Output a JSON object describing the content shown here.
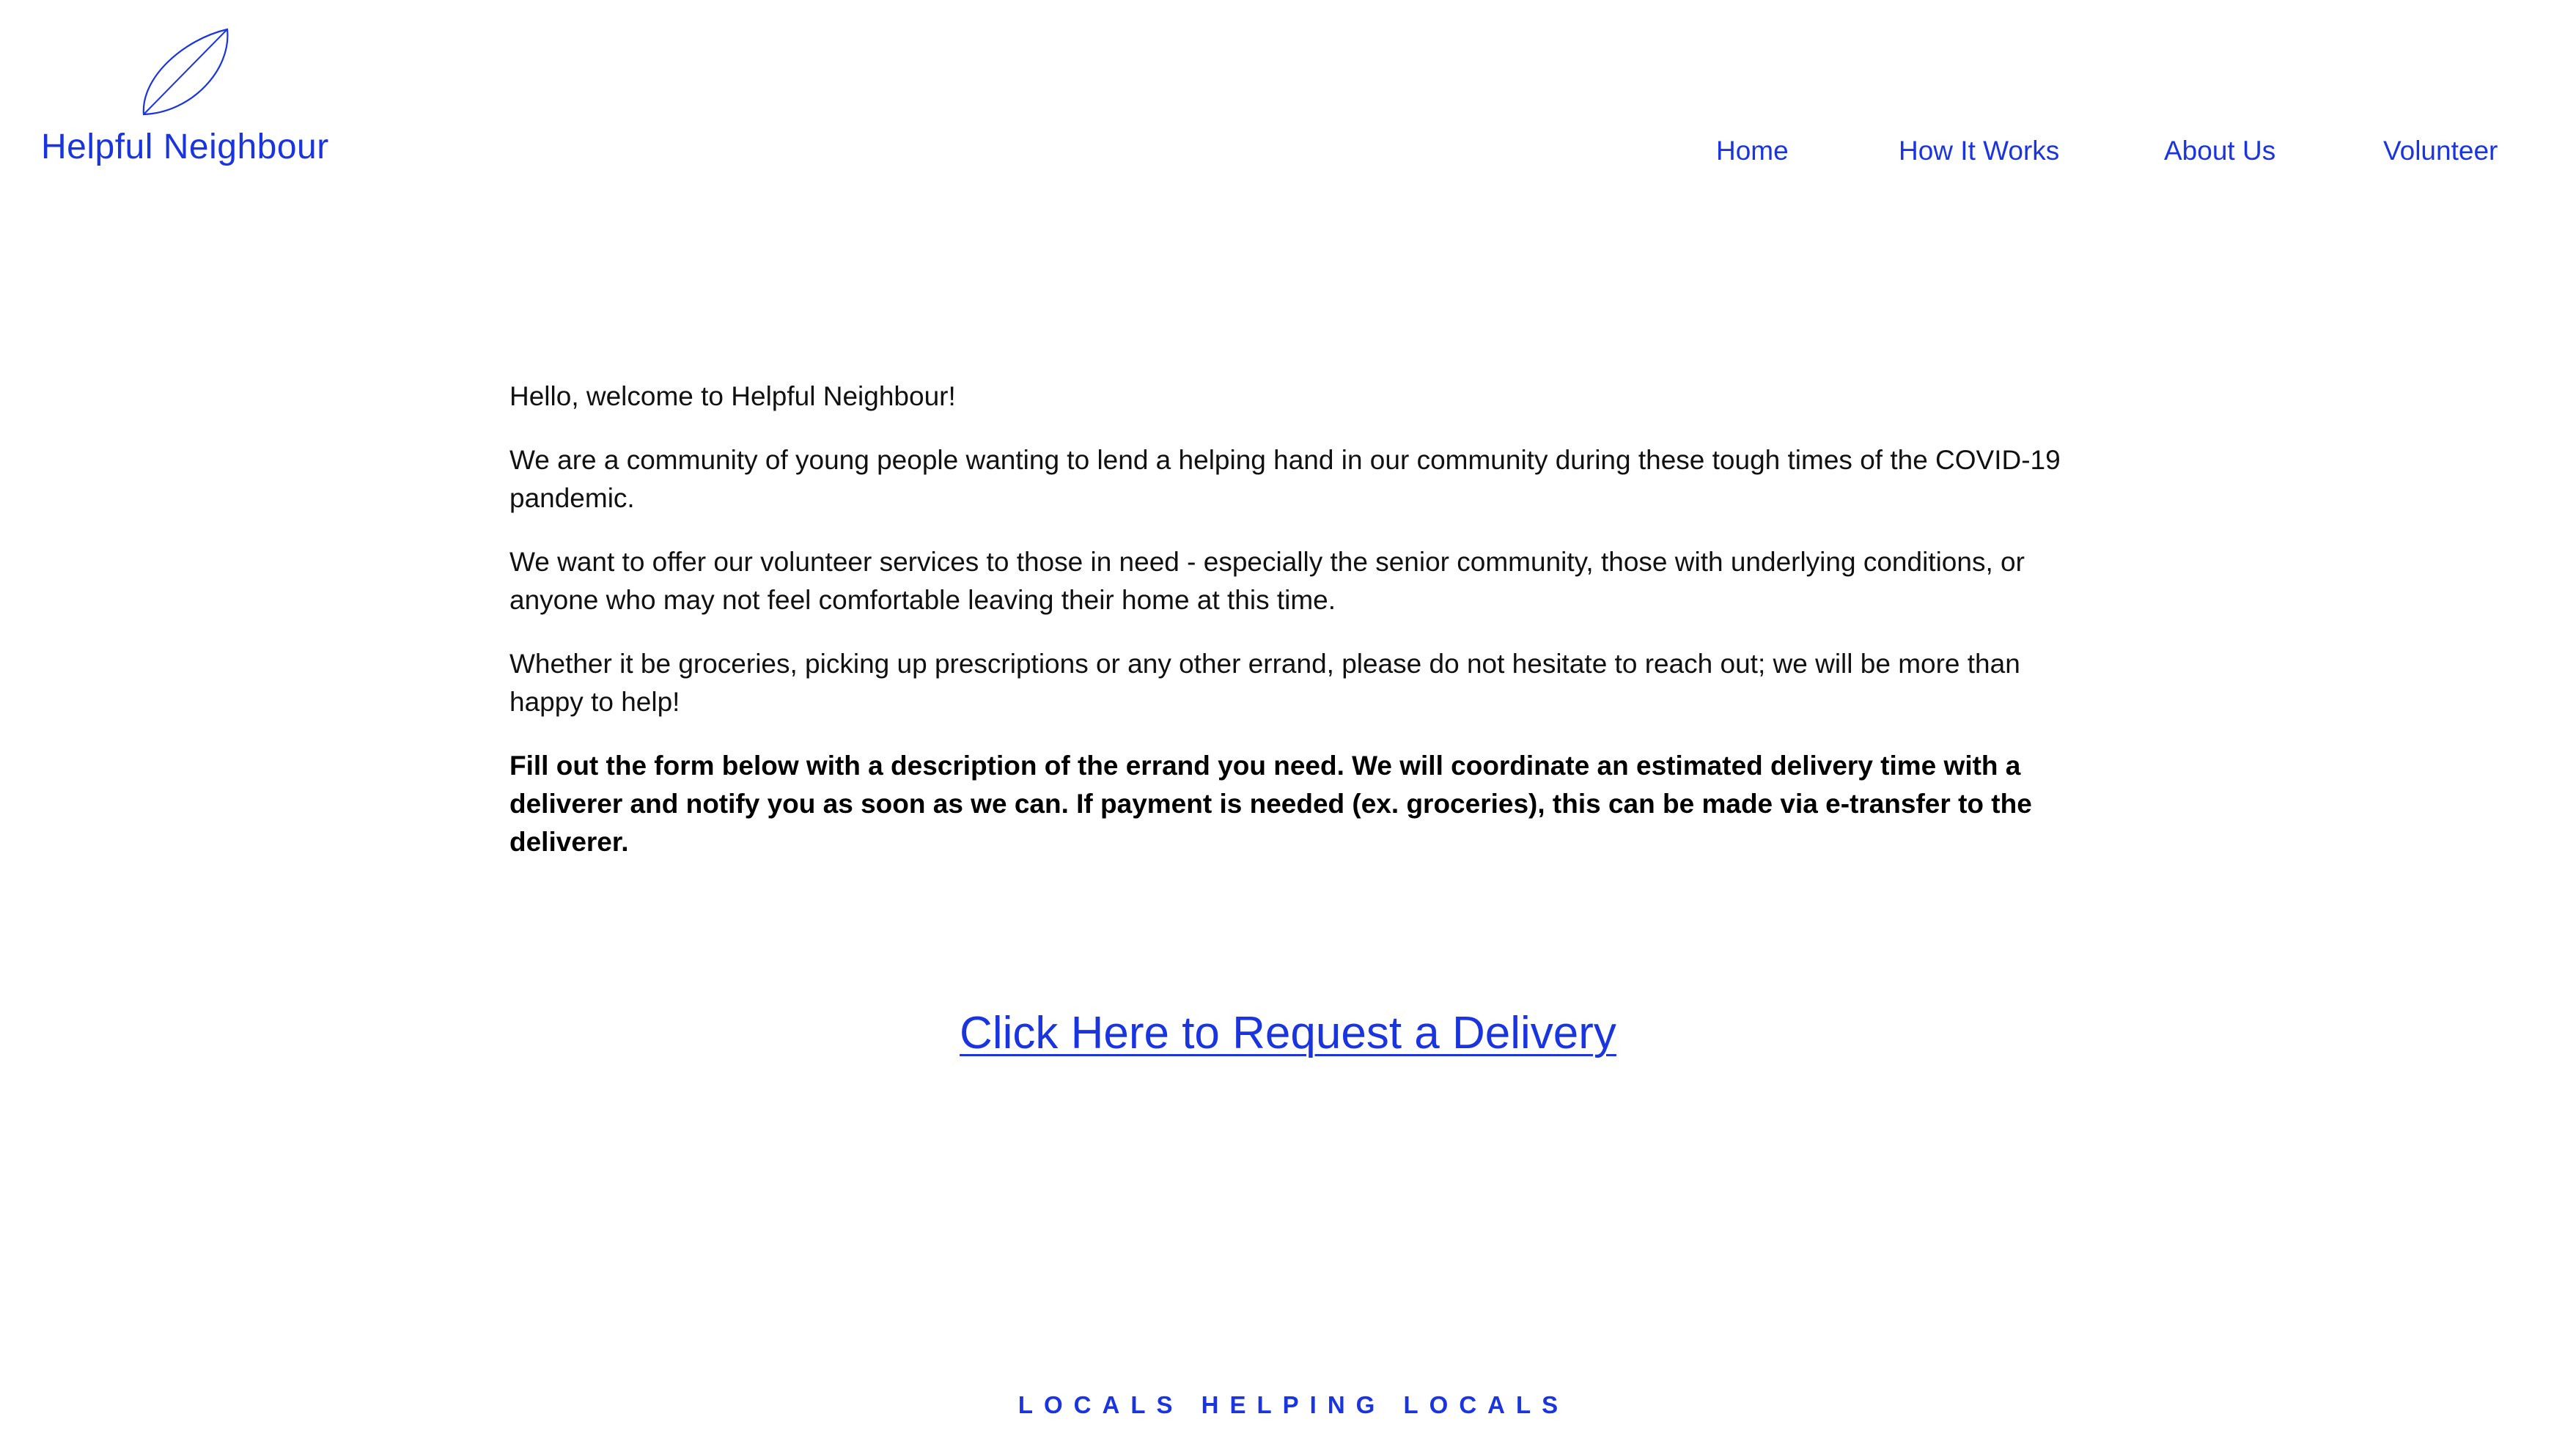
{
  "brand": {
    "name": "Helpful Neighbour",
    "logo_icon": "leaf-icon",
    "color": "#1a35e0"
  },
  "nav": {
    "items": [
      {
        "label": "Home"
      },
      {
        "label": "How It Works"
      },
      {
        "label": "About Us"
      },
      {
        "label": "Volunteer"
      }
    ]
  },
  "intro": {
    "paragraphs": [
      "Hello, welcome to Helpful Neighbour!",
      "We are a community of young people wanting to lend a helping hand in our community during these tough times of the COVID-19 pandemic.",
      "We want to offer our volunteer services to those in need - especially the senior community, those with underlying conditions, or anyone who may not feel comfortable leaving their home at this time.",
      "Whether it be groceries, picking up prescriptions or any other errand, please do not hesitate to reach out; we will be more than happy to help!"
    ],
    "instructions": "Fill out the form below with a description of the errand you need. We will coordinate an estimated delivery time with a deliverer and notify you as soon as we can. If payment is needed (ex. groceries), this can be made via e-transfer to the deliverer."
  },
  "cta": {
    "label": "Click Here to Request a Delivery"
  },
  "footer": {
    "tagline": "LOCALS HELPING LOCALS"
  }
}
